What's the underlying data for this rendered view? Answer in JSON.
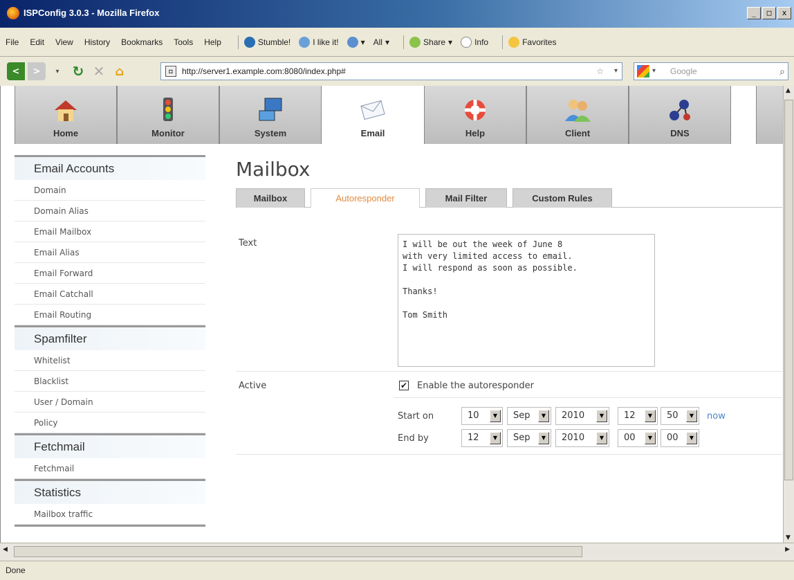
{
  "window": {
    "title": "ISPConfig 3.0.3 - Mozilla Firefox",
    "min": "_",
    "max": "□",
    "close": "x"
  },
  "menu": {
    "items": [
      "File",
      "Edit",
      "View",
      "History",
      "Bookmarks",
      "Tools",
      "Help"
    ],
    "toolbar": [
      "Stumble!",
      "I like it!",
      "All",
      "Share",
      "Info",
      "Favorites"
    ]
  },
  "nav": {
    "url": "http://server1.example.com:8080/index.php#",
    "search_placeholder": "Google"
  },
  "modules": [
    {
      "label": "Home",
      "icon": "home-icon"
    },
    {
      "label": "Monitor",
      "icon": "traffic-light-icon"
    },
    {
      "label": "System",
      "icon": "computer-icon"
    },
    {
      "label": "Email",
      "icon": "envelope-icon"
    },
    {
      "label": "Help",
      "icon": "lifebuoy-icon"
    },
    {
      "label": "Client",
      "icon": "users-icon"
    },
    {
      "label": "DNS",
      "icon": "network-icon"
    }
  ],
  "sidebar": {
    "sections": [
      {
        "title": "Email Accounts",
        "items": [
          "Domain",
          "Domain Alias",
          "Email Mailbox",
          "Email Alias",
          "Email Forward",
          "Email Catchall",
          "Email Routing"
        ]
      },
      {
        "title": "Spamfilter",
        "items": [
          "Whitelist",
          "Blacklist",
          "User / Domain",
          "Policy"
        ]
      },
      {
        "title": "Fetchmail",
        "items": [
          "Fetchmail"
        ]
      },
      {
        "title": "Statistics",
        "items": [
          "Mailbox traffic"
        ]
      }
    ]
  },
  "main": {
    "title": "Mailbox",
    "tabs": [
      "Mailbox",
      "Autoresponder",
      "Mail Filter",
      "Custom Rules"
    ],
    "active_tab": "Autoresponder",
    "text_label": "Text",
    "text_value": "I will be out the week of June 8\nwith very limited access to email.\nI will respond as soon as possible.\n\nThanks!\n\nTom Smith",
    "active_label": "Active",
    "enable_label": "Enable the autoresponder",
    "start_label": "Start on",
    "end_label": "End by",
    "start": {
      "day": "10",
      "month": "Sep",
      "year": "2010",
      "hour": "12",
      "minute": "50"
    },
    "end": {
      "day": "12",
      "month": "Sep",
      "year": "2010",
      "hour": "00",
      "minute": "00"
    },
    "now_link": "now"
  },
  "status": "Done",
  "colors": {
    "active_tab_text": "#e18a3c",
    "link": "#4a86c7"
  }
}
